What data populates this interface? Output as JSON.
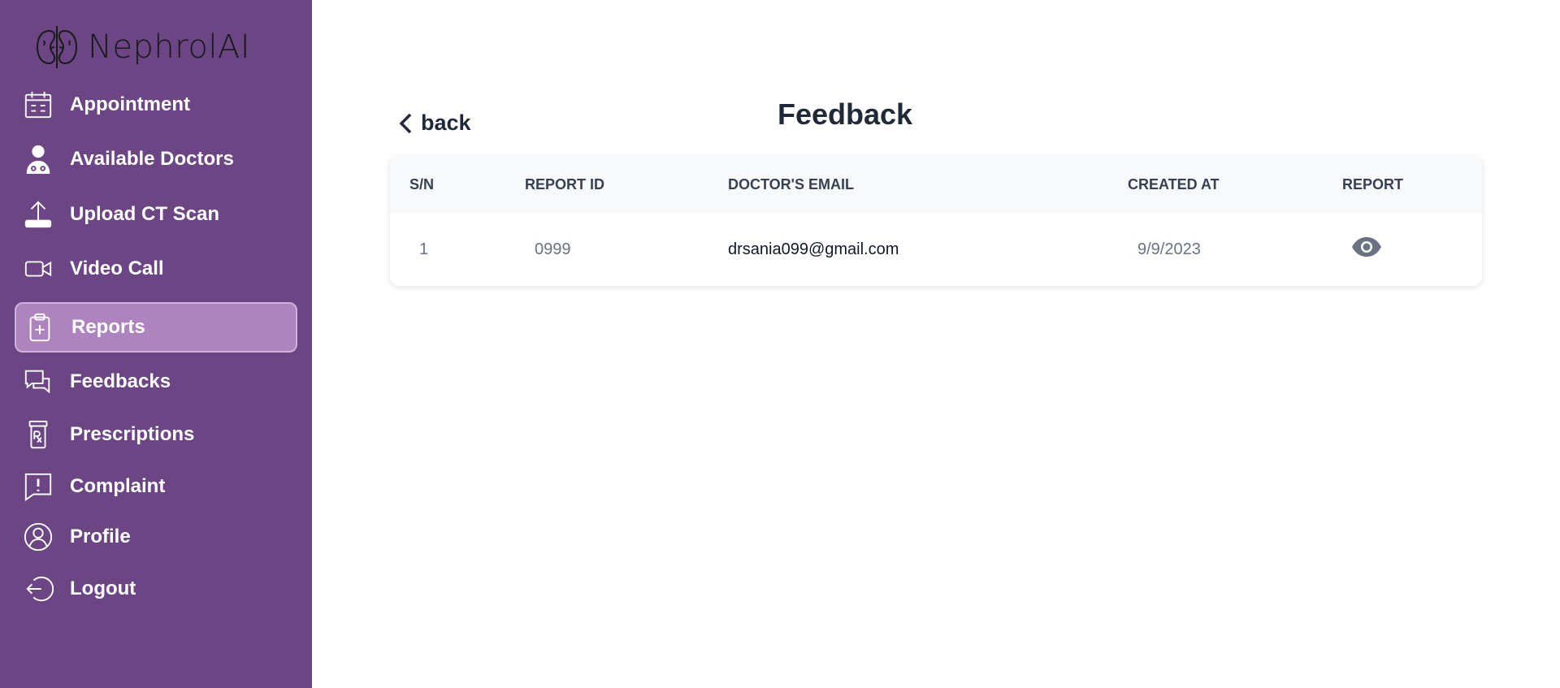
{
  "app": {
    "name": "NephrolAI"
  },
  "sidebar": {
    "items": [
      {
        "label": "Appointment",
        "icon": "calendar-icon"
      },
      {
        "label": "Available Doctors",
        "icon": "doctor-icon"
      },
      {
        "label": "Upload CT Scan",
        "icon": "upload-icon"
      },
      {
        "label": "Video Call",
        "icon": "video-icon"
      },
      {
        "label": "Reports",
        "icon": "clipboard-plus-icon",
        "active": true
      },
      {
        "label": "Feedbacks",
        "icon": "chat-bubbles-icon"
      },
      {
        "label": "Prescriptions",
        "icon": "prescription-icon"
      },
      {
        "label": "Complaint",
        "icon": "alert-message-icon"
      },
      {
        "label": "Profile",
        "icon": "user-circle-icon"
      },
      {
        "label": "Logout",
        "icon": "logout-icon"
      }
    ]
  },
  "main": {
    "back_label": "back",
    "title": "Feedback",
    "table": {
      "headers": [
        "S/N",
        "REPORT ID",
        "DOCTOR'S EMAIL",
        "CREATED AT",
        "REPORT"
      ],
      "rows": [
        {
          "sn": "1",
          "report_id": "0999",
          "email": "drsania099@gmail.com",
          "created_at": "9/9/2023",
          "report_icon": "eye-icon"
        }
      ]
    }
  },
  "colors": {
    "sidebar_bg": "#6b4584",
    "active_item_bg": "#ae84bf",
    "text_dark": "#1f2937",
    "icon_gray": "#6b7280"
  }
}
